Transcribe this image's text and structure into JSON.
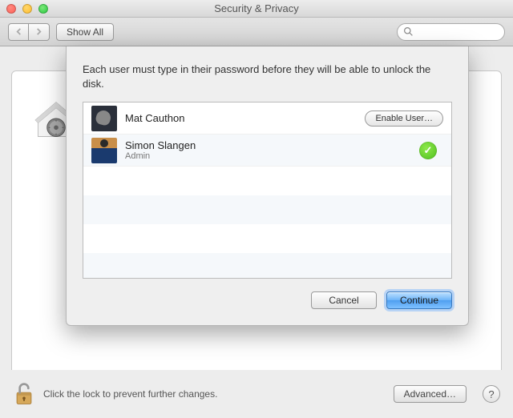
{
  "window": {
    "title": "Security & Privacy"
  },
  "toolbar": {
    "show_all": "Show All",
    "search_placeholder": ""
  },
  "sheet": {
    "message": "Each user must type in their password before they will be able to unlock the disk.",
    "users": [
      {
        "name": "Mat Cauthon",
        "role": "",
        "enabled": false
      },
      {
        "name": "Simon Slangen",
        "role": "Admin",
        "enabled": true
      }
    ],
    "enable_user_label": "Enable User…",
    "cancel": "Cancel",
    "continue": "Continue"
  },
  "footer": {
    "lock_text": "Click the lock to prevent further changes.",
    "advanced": "Advanced…"
  }
}
